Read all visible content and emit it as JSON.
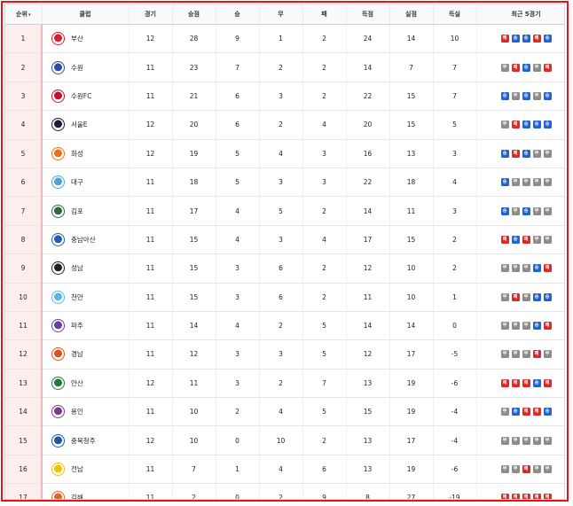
{
  "headers": {
    "rank": "순위",
    "club": "클럽",
    "played": "경기",
    "points": "승점",
    "won": "승",
    "drawn": "무",
    "lost": "패",
    "gf": "득점",
    "ga": "실점",
    "gd": "득실",
    "form": "최근 5경기"
  },
  "sort_indicator": "▾",
  "form_labels": {
    "W": "승",
    "D": "무",
    "L": "패"
  },
  "colors": {
    "frame": "#e3141b",
    "win": "#1f63d6",
    "draw": "#8c8c8c",
    "loss": "#e02828",
    "rank_bg": "#fdeeee"
  },
  "rows": [
    {
      "rank": "1",
      "club": "부산",
      "emblem_color": "#d6202b",
      "played": "12",
      "points": "28",
      "won": "9",
      "drawn": "1",
      "lost": "2",
      "gf": "24",
      "ga": "14",
      "gd": "10",
      "form": [
        "L",
        "W",
        "W",
        "L",
        "W"
      ]
    },
    {
      "rank": "2",
      "club": "수원",
      "emblem_color": "#2a4ea3",
      "played": "11",
      "points": "23",
      "won": "7",
      "drawn": "2",
      "lost": "2",
      "gf": "14",
      "ga": "7",
      "gd": "7",
      "form": [
        "D",
        "L",
        "W",
        "D",
        "L"
      ]
    },
    {
      "rank": "3",
      "club": "수원FC",
      "emblem_color": "#c8102e",
      "played": "11",
      "points": "21",
      "won": "6",
      "drawn": "3",
      "lost": "2",
      "gf": "22",
      "ga": "15",
      "gd": "7",
      "form": [
        "W",
        "D",
        "W",
        "D",
        "W"
      ]
    },
    {
      "rank": "4",
      "club": "서울E",
      "emblem_color": "#1b1b3a",
      "played": "12",
      "points": "20",
      "won": "6",
      "drawn": "2",
      "lost": "4",
      "gf": "20",
      "ga": "15",
      "gd": "5",
      "form": [
        "D",
        "L",
        "W",
        "W",
        "W"
      ]
    },
    {
      "rank": "5",
      "club": "화성",
      "emblem_color": "#e8731a",
      "played": "12",
      "points": "19",
      "won": "5",
      "drawn": "4",
      "lost": "3",
      "gf": "16",
      "ga": "13",
      "gd": "3",
      "form": [
        "W",
        "L",
        "W",
        "D",
        "D"
      ]
    },
    {
      "rank": "6",
      "club": "대구",
      "emblem_color": "#4fa3d8",
      "played": "11",
      "points": "18",
      "won": "5",
      "drawn": "3",
      "lost": "3",
      "gf": "22",
      "ga": "18",
      "gd": "4",
      "form": [
        "W",
        "D",
        "D",
        "D",
        "D"
      ]
    },
    {
      "rank": "7",
      "club": "김포",
      "emblem_color": "#2f6b3a",
      "played": "11",
      "points": "17",
      "won": "4",
      "drawn": "5",
      "lost": "2",
      "gf": "14",
      "ga": "11",
      "gd": "3",
      "form": [
        "W",
        "D",
        "W",
        "D",
        "D"
      ]
    },
    {
      "rank": "8",
      "club": "충남아산",
      "emblem_color": "#1f5fae",
      "played": "11",
      "points": "15",
      "won": "4",
      "drawn": "3",
      "lost": "4",
      "gf": "17",
      "ga": "15",
      "gd": "2",
      "form": [
        "L",
        "W",
        "L",
        "D",
        "D"
      ]
    },
    {
      "rank": "9",
      "club": "성남",
      "emblem_color": "#222222",
      "played": "11",
      "points": "15",
      "won": "3",
      "drawn": "6",
      "lost": "2",
      "gf": "12",
      "ga": "10",
      "gd": "2",
      "form": [
        "D",
        "D",
        "D",
        "W",
        "L"
      ]
    },
    {
      "rank": "10",
      "club": "천안",
      "emblem_color": "#5ab4e5",
      "played": "11",
      "points": "15",
      "won": "3",
      "drawn": "6",
      "lost": "2",
      "gf": "11",
      "ga": "10",
      "gd": "1",
      "form": [
        "D",
        "L",
        "D",
        "W",
        "W"
      ]
    },
    {
      "rank": "11",
      "club": "파주",
      "emblem_color": "#6b3fa0",
      "played": "11",
      "points": "14",
      "won": "4",
      "drawn": "2",
      "lost": "5",
      "gf": "14",
      "ga": "14",
      "gd": "0",
      "form": [
        "D",
        "D",
        "D",
        "W",
        "L"
      ]
    },
    {
      "rank": "12",
      "club": "경남",
      "emblem_color": "#d9531e",
      "played": "11",
      "points": "12",
      "won": "3",
      "drawn": "3",
      "lost": "5",
      "gf": "12",
      "ga": "17",
      "gd": "-5",
      "form": [
        "D",
        "D",
        "D",
        "L",
        "D"
      ]
    },
    {
      "rank": "13",
      "club": "안산",
      "emblem_color": "#1e7a3c",
      "played": "12",
      "points": "11",
      "won": "3",
      "drawn": "2",
      "lost": "7",
      "gf": "13",
      "ga": "19",
      "gd": "-6",
      "form": [
        "L",
        "L",
        "L",
        "W",
        "L"
      ]
    },
    {
      "rank": "14",
      "club": "용인",
      "emblem_color": "#7a3c8c",
      "played": "11",
      "points": "10",
      "won": "2",
      "drawn": "4",
      "lost": "5",
      "gf": "15",
      "ga": "19",
      "gd": "-4",
      "form": [
        "D",
        "W",
        "L",
        "L",
        "W"
      ]
    },
    {
      "rank": "15",
      "club": "충북청주",
      "emblem_color": "#2456a6",
      "played": "12",
      "points": "10",
      "won": "0",
      "drawn": "10",
      "lost": "2",
      "gf": "13",
      "ga": "17",
      "gd": "-4",
      "form": [
        "D",
        "D",
        "D",
        "D",
        "D"
      ]
    },
    {
      "rank": "16",
      "club": "전남",
      "emblem_color": "#f2c200",
      "played": "11",
      "points": "7",
      "won": "1",
      "drawn": "4",
      "lost": "6",
      "gf": "13",
      "ga": "19",
      "gd": "-6",
      "form": [
        "D",
        "D",
        "L",
        "D",
        "D"
      ]
    },
    {
      "rank": "17",
      "club": "김해",
      "emblem_color": "#e0672a",
      "played": "11",
      "points": "2",
      "won": "0",
      "drawn": "2",
      "lost": "9",
      "gf": "8",
      "ga": "27",
      "gd": "-19",
      "form": [
        "L",
        "L",
        "L",
        "L",
        "L"
      ]
    }
  ]
}
